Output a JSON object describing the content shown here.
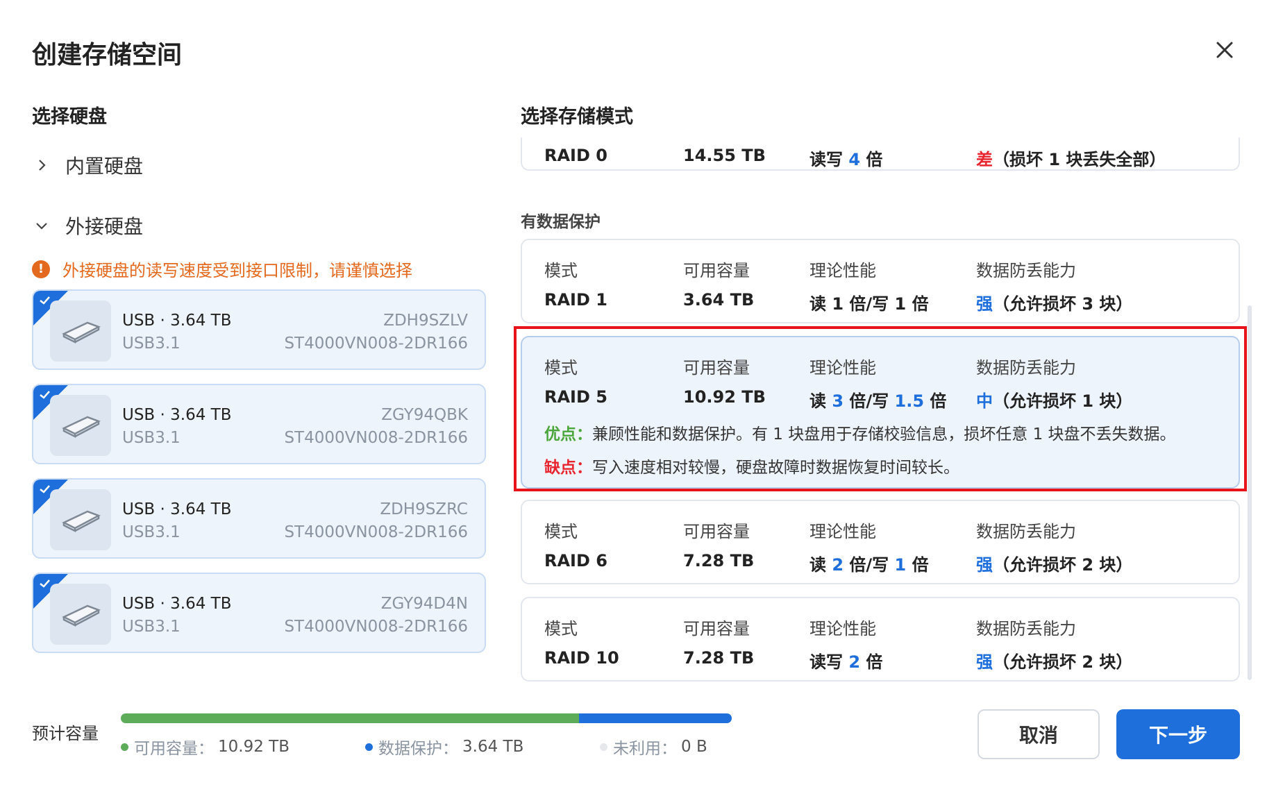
{
  "dialog": {
    "title": "创建存储空间"
  },
  "left": {
    "section_title": "选择硬盘",
    "groups": [
      {
        "label": "内置硬盘",
        "expanded": false
      },
      {
        "label": "外接硬盘",
        "expanded": true
      }
    ],
    "warning": "外接硬盘的读写速度受到接口限制，请谨慎选择",
    "disks": [
      {
        "name": "USB · 3.64 TB",
        "interface": "USB3.1",
        "serial": "ZDH9SZLV",
        "model": "ST4000VN008-2DR166",
        "selected": true
      },
      {
        "name": "USB · 3.64 TB",
        "interface": "USB3.1",
        "serial": "ZGY94QBK",
        "model": "ST4000VN008-2DR166",
        "selected": true
      },
      {
        "name": "USB · 3.64 TB",
        "interface": "USB3.1",
        "serial": "ZDH9SZRC",
        "model": "ST4000VN008-2DR166",
        "selected": true
      },
      {
        "name": "USB · 3.64 TB",
        "interface": "USB3.1",
        "serial": "ZGY94D4N",
        "model": "ST4000VN008-2DR166",
        "selected": true
      }
    ]
  },
  "right": {
    "section_title": "选择存储模式",
    "protected_label": "有数据保护",
    "headers": {
      "mode": "模式",
      "capacity": "可用容量",
      "performance": "理论性能",
      "protection": "数据防丢能力"
    },
    "raid0": {
      "mode": "RAID 0",
      "capacity": "14.55 TB",
      "perf_a": "读写 ",
      "perf_n1": "4",
      "perf_b": " 倍",
      "prot_level": "差",
      "prot_desc": "（损坏 1 块丢失全部）"
    },
    "raid1": {
      "mode": "RAID 1",
      "capacity": "3.64 TB",
      "perf": "读 1 倍/写 1 倍",
      "prot_level": "强",
      "prot_desc": "（允许损坏 3 块）"
    },
    "raid5": {
      "mode": "RAID 5",
      "capacity": "10.92 TB",
      "perf_a": "读 ",
      "perf_n1": "3",
      "perf_b": " 倍/写 ",
      "perf_n2": "1.5",
      "perf_c": " 倍",
      "prot_level": "中",
      "prot_desc": "（允许损坏 1 块）",
      "pros_label": "优点：",
      "pros": "兼顾性能和数据保护。有 1 块盘用于存储校验信息，损坏任意 1 块盘不丢失数据。",
      "cons_label": "缺点：",
      "cons": "写入速度相对较慢，硬盘故障时数据恢复时间较长。",
      "selected": true
    },
    "raid6": {
      "mode": "RAID 6",
      "capacity": "7.28 TB",
      "perf_a": "读 ",
      "perf_n1": "2",
      "perf_b": " 倍/写 ",
      "perf_n2": "1",
      "perf_c": " 倍",
      "prot_level": "强",
      "prot_desc": "（允许损坏 2 块）"
    },
    "raid10": {
      "mode": "RAID 10",
      "capacity": "7.28 TB",
      "perf_a": "读写 ",
      "perf_n1": "2",
      "perf_b": " 倍",
      "prot_level": "强",
      "prot_desc": "（允许损坏 2 块）"
    }
  },
  "footer": {
    "label": "预计容量",
    "usage": {
      "available_fraction": 0.75,
      "protection_fraction": 0.25,
      "unused_fraction": 0
    },
    "legend": [
      {
        "label": "可用容量：",
        "value": "10.92 TB",
        "color": "#5cac5a"
      },
      {
        "label": "数据保护：",
        "value": "3.64 TB",
        "color": "#1e6fdc"
      },
      {
        "label": "未利用：",
        "value": "0 B",
        "color": "#e6e8eb"
      }
    ],
    "cancel_label": "取消",
    "next_label": "下一步"
  }
}
